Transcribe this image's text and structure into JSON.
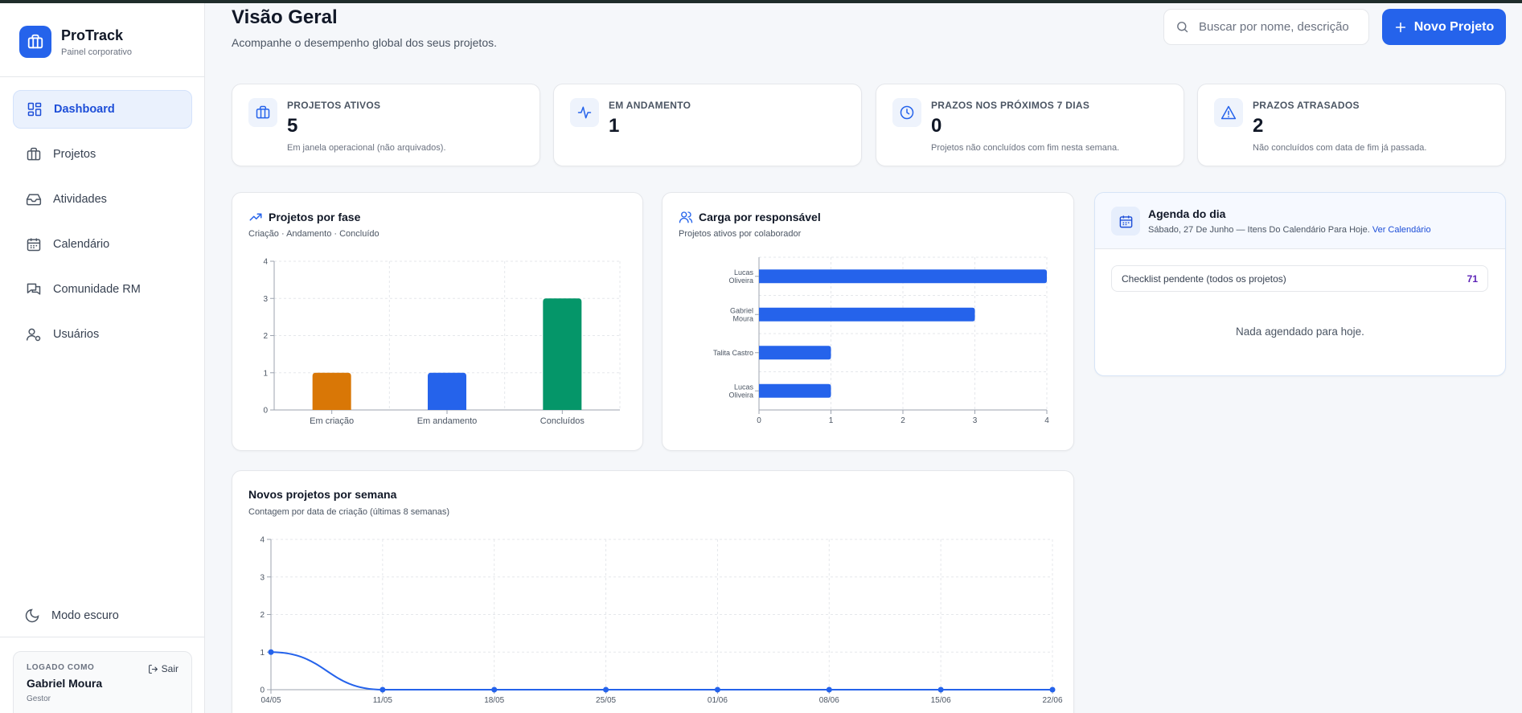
{
  "brand": {
    "name": "ProTrack",
    "subtitle": "Painel corporativo"
  },
  "sidebar": {
    "items": [
      {
        "label": "Dashboard",
        "icon": "dashboard-grid-icon",
        "active": true
      },
      {
        "label": "Projetos",
        "icon": "briefcase-icon",
        "active": false
      },
      {
        "label": "Atividades",
        "icon": "inbox-icon",
        "active": false
      },
      {
        "label": "Calendário",
        "icon": "calendar-icon",
        "active": false
      },
      {
        "label": "Comunidade RM",
        "icon": "chat-icon",
        "active": false
      },
      {
        "label": "Usuários",
        "icon": "user-cog-icon",
        "active": false
      }
    ],
    "dark_mode_label": "Modo escuro",
    "user": {
      "label": "LOGADO COMO",
      "name": "Gabriel Moura",
      "role": "Gestor",
      "logout_label": "Sair"
    }
  },
  "header": {
    "title": "Visão Geral",
    "subtitle": "Acompanhe o desempenho global dos seus projetos.",
    "search_placeholder": "Buscar por nome, descrição",
    "new_project_label": "Novo Projeto"
  },
  "stats": [
    {
      "label": "PROJETOS ATIVOS",
      "value": "5",
      "note": "Em janela operacional (não arquivados).",
      "icon": "briefcase-icon"
    },
    {
      "label": "EM ANDAMENTO",
      "value": "1",
      "note": "",
      "icon": "activity-icon"
    },
    {
      "label": "PRAZOS NOS PRÓXIMOS 7 DIAS",
      "value": "0",
      "note": "Projetos não concluídos com fim nesta semana.",
      "icon": "clock-icon"
    },
    {
      "label": "PRAZOS ATRASADOS",
      "value": "2",
      "note": "Não concluídos com data de fim já passada.",
      "icon": "alert-triangle-icon"
    }
  ],
  "panels": {
    "phase": {
      "title": "Projetos por fase",
      "subtitle": "Criação · Andamento · Concluído"
    },
    "load": {
      "title": "Carga por responsável",
      "subtitle": "Projetos ativos por colaborador"
    },
    "weekly": {
      "title": "Novos projetos por semana",
      "subtitle": "Contagem por data de criação (últimas 8 semanas)"
    },
    "agenda": {
      "title": "Agenda do dia",
      "subtitle": "Sábado, 27 De Junho — Itens Do Calendário Para Hoje.",
      "link": "Ver Calendário",
      "checklist_label": "Checklist pendente (todos os projetos)",
      "checklist_count": "71",
      "empty": "Nada agendado para hoje."
    }
  },
  "colors": {
    "primary": "#2563eb",
    "orange": "#d97706",
    "green": "#059669",
    "purple": "#5b21b6"
  },
  "chart_data": [
    {
      "type": "bar",
      "categories": [
        "Em criação",
        "Em andamento",
        "Concluídos"
      ],
      "values": [
        1,
        1,
        3
      ],
      "colors": [
        "#d97706",
        "#2563eb",
        "#059669"
      ],
      "ylim": [
        0,
        4
      ],
      "yticks": [
        0,
        1,
        2,
        3,
        4
      ],
      "grid": true
    },
    {
      "type": "bar",
      "orientation": "horizontal",
      "categories": [
        [
          "Lucas",
          "Oliveira"
        ],
        [
          "Gabriel",
          "Moura"
        ],
        [
          "Talita Castro"
        ],
        [
          "Lucas",
          "Oliveira"
        ]
      ],
      "values": [
        4,
        3,
        1,
        1
      ],
      "xlim": [
        0,
        4
      ],
      "xticks": [
        0,
        1,
        2,
        3,
        4
      ],
      "grid": true
    },
    {
      "type": "line",
      "x": [
        "04/05",
        "11/05",
        "18/05",
        "25/05",
        "01/06",
        "08/06",
        "15/06",
        "22/06"
      ],
      "values": [
        1,
        0,
        0,
        0,
        0,
        0,
        0,
        0
      ],
      "ylim": [
        0,
        4
      ],
      "yticks": [
        0,
        1,
        2,
        3,
        4
      ],
      "grid": true
    }
  ]
}
